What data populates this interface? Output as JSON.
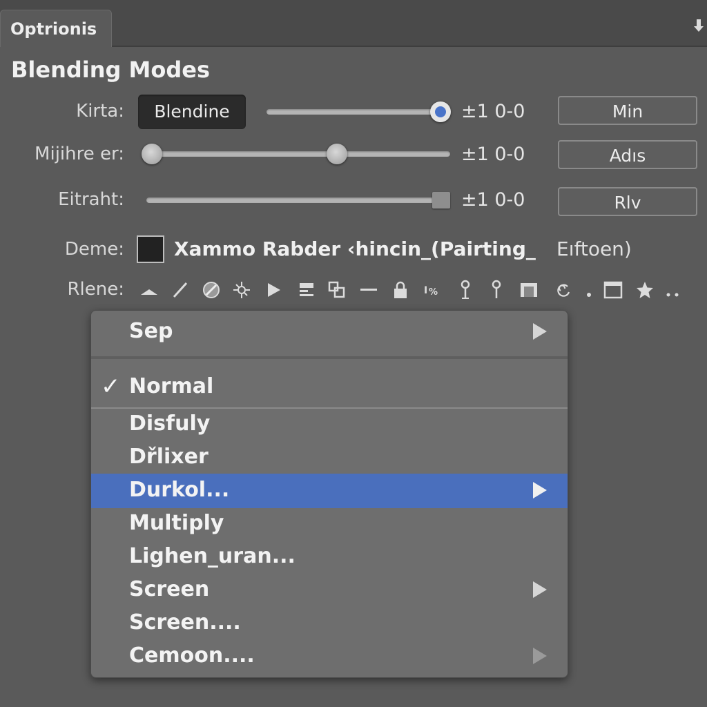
{
  "panel": {
    "tab_label": "Optrionis",
    "title": "Blending Modes"
  },
  "rows": {
    "kirta": {
      "label": "Kirta:",
      "field_value": "Blendine",
      "value": "±1 0-0",
      "button": "Min",
      "slider_level": 0.96
    },
    "mijihre": {
      "label": "Mijihre er:",
      "value": "±1 0-0",
      "button": "Adıs",
      "slider_min_level": 0.0,
      "slider_max_level": 0.6
    },
    "eitraht": {
      "label": "Eitraht:",
      "value": "±1 0-0",
      "button": "Rlv",
      "slider_level": 0.99
    },
    "deme": {
      "label": "Deme:",
      "text": "Xammo Rabder ‹hincin_(Pairting_",
      "right_text": "Eıftoen)"
    },
    "rlene": {
      "label": "Rlene:"
    }
  },
  "tools": [
    "mountain-icon",
    "line-icon",
    "no-entry-icon",
    "sparkle-icon",
    "play-icon",
    "stack-icon",
    "squares-icon",
    "dash-icon",
    "lock-icon",
    "transform-icon",
    "pin-icon",
    "pin-alt-icon",
    "frame-icon",
    "swirl-icon",
    "dot-icon",
    "window-icon",
    "star-icon",
    "more-icon"
  ],
  "menu": {
    "items": [
      {
        "label": "Sep",
        "submenu": true
      },
      {
        "label": "Normal",
        "checked": true
      },
      {
        "label": "Disfuly"
      },
      {
        "label": "Dřlixer"
      },
      {
        "label": "Durkol...",
        "submenu": true,
        "selected": true
      },
      {
        "label": "Multiply"
      },
      {
        "label": "Lighen_uran..."
      },
      {
        "label": "Screen",
        "submenu": true
      },
      {
        "label": "Screen...."
      },
      {
        "label": "Cemoon....",
        "submenu": true,
        "submenu_dim": true
      }
    ]
  },
  "colors": {
    "background": "#5a5a5a",
    "selection": "#4a6fbd",
    "accent_knob": "#4a74c9"
  }
}
